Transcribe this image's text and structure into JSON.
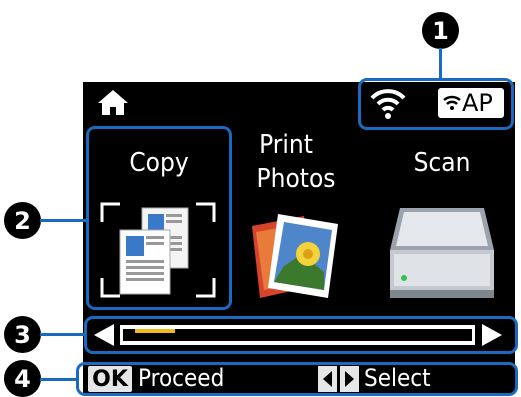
{
  "callouts": {
    "c1": "1",
    "c2": "2",
    "c3": "3",
    "c4": "4"
  },
  "status": {
    "ap_label": "AP"
  },
  "menu": {
    "copy_label": "Copy",
    "print_line1": "Print",
    "print_line2": "Photos",
    "scan_label": "Scan"
  },
  "scroll": {
    "position_fraction": 0.02
  },
  "footer": {
    "ok_key": "OK",
    "proceed_label": "Proceed",
    "select_label": "Select"
  },
  "colors": {
    "highlight": "#1a6bbf",
    "scroll_thumb": "#f2b81a",
    "screen_bg": "#000000"
  }
}
